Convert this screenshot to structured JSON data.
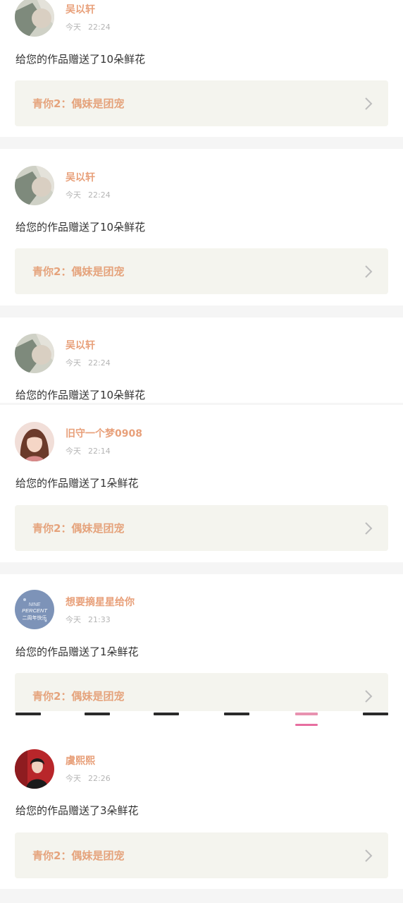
{
  "feed": {
    "items": [
      {
        "user": "吴以轩",
        "day": "今天",
        "time": "22:24",
        "message": "给您的作品赠送了10朵鲜花",
        "card_title": "青你2：偶妹是团宠"
      },
      {
        "user": "吴以轩",
        "day": "今天",
        "time": "22:24",
        "message": "给您的作品赠送了10朵鲜花",
        "card_title": "青你2：偶妹是团宠"
      },
      {
        "user": "吴以轩",
        "day": "今天",
        "time": "22:24",
        "message": "给您的作品赠送了10朵鲜花"
      },
      {
        "user": "旧守一个梦0908",
        "day": "今天",
        "time": "22:14",
        "message": "给您的作品赠送了1朵鲜花",
        "card_title": "青你2：偶妹是团宠"
      },
      {
        "user": "想要摘星星给你",
        "day": "今天",
        "time": "21:33",
        "message": "给您的作品赠送了1朵鲜花",
        "card_title": "青你2：偶妹是团宠"
      },
      {
        "user": "虞熙熙",
        "day": "今天",
        "time": "22:26",
        "message": "给您的作品赠送了3朵鲜花",
        "card_title": "青你2：偶妹是团宠"
      }
    ],
    "avatar_badge_text": [
      "NINE",
      "PERCENT",
      "二周年快乐"
    ]
  },
  "colors": {
    "username": "#e8a07a",
    "card_title": "#e5a37c",
    "card_bg": "#f4f4ee",
    "tab_indicator": "#e76ea0"
  },
  "icons": [
    "avatar-image",
    "chevron-right-icon"
  ]
}
